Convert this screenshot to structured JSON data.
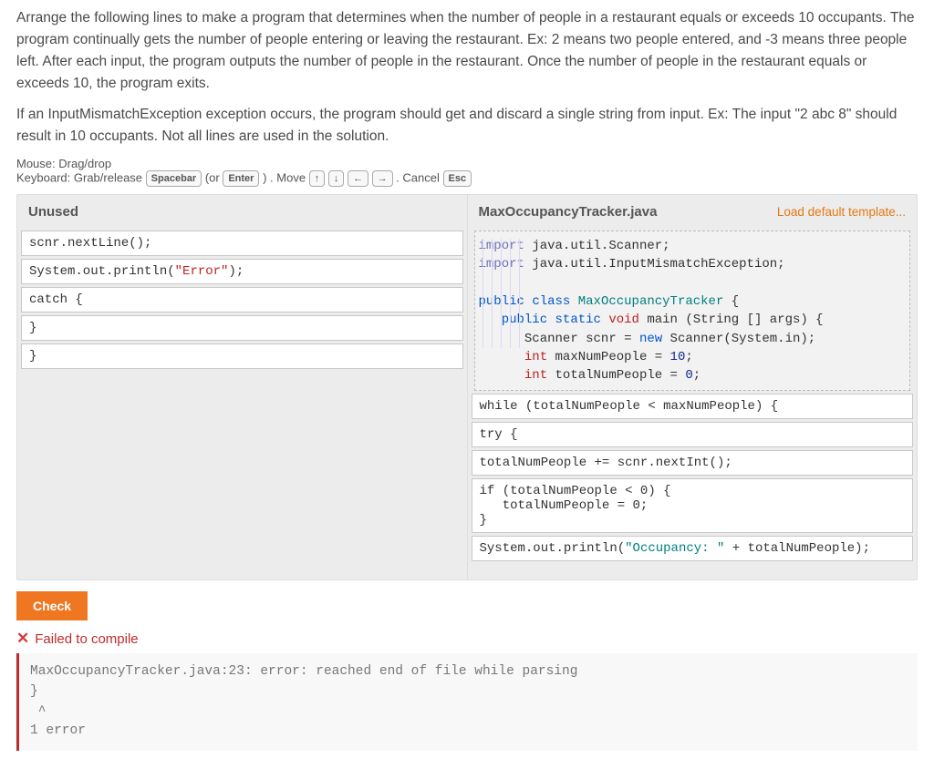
{
  "instructions": {
    "p1": "Arrange the following lines to make a program that determines when the number of people in a restaurant equals or exceeds 10 occupants. The program continually gets the number of people entering or leaving the restaurant. Ex: 2 means two people entered, and -3 means three people left. After each input, the program outputs the number of people in the restaurant. Once the number of people in the restaurant equals or exceeds 10, the program exits.",
    "p2": "If an InputMismatchException exception occurs, the program should get and discard a single string from input. Ex: The input \"2 abc 8\" should result in 10 occupants. Not all lines are used in the solution."
  },
  "hints": {
    "mouse": "Mouse: Drag/drop",
    "kb_prefix": "Keyboard: Grab/release",
    "kb_move": ". Move",
    "kb_cancel": ". Cancel",
    "or": "(or",
    "close_paren": ")",
    "key_spacebar": "Spacebar",
    "key_enter": "Enter",
    "key_up": "↑",
    "key_down": "↓",
    "key_left": "←",
    "key_right": "→",
    "key_esc": "Esc"
  },
  "left": {
    "header": "Unused",
    "items": [
      "scnr.nextLine();",
      "System.out.println(\"Error\");",
      "catch {",
      "}",
      "}"
    ]
  },
  "right": {
    "header": "MaxOccupancyTracker.java",
    "link": "Load default template...",
    "top_block": {
      "l0a": "import",
      "l0b": " java.util.Scanner;",
      "l1a": "import",
      "l1b": " java.util.InputMismatchException;",
      "blank": "",
      "l2a": "public ",
      "l2b": "class ",
      "l2c": "MaxOccupancyTracker",
      "l2d": " {",
      "l3a": "   public ",
      "l3b": "static ",
      "l3c": "void",
      "l3d": " main ",
      "l3e": "(String [] args) {",
      "l4a": "      Scanner scnr = ",
      "l4b": "new",
      "l4c": " Scanner(System.in);",
      "l5a": "      int",
      "l5b": " maxNumPeople = ",
      "l5c": "10",
      "l5d": ";",
      "l6a": "      int",
      "l6b": " totalNumPeople = ",
      "l6c": "0",
      "l6d": ";"
    },
    "placed": [
      "while (totalNumPeople < maxNumPeople) {",
      "try {",
      "totalNumPeople += scnr.nextInt();",
      "if (totalNumPeople < 0) {\n   totalNumPeople = 0;\n}"
    ],
    "placed_last_prefix": "System.out.println(",
    "placed_last_str": "\"Occupancy: \"",
    "placed_last_suffix": " + totalNumPeople);"
  },
  "buttons": {
    "check": "Check"
  },
  "result": {
    "x": "✕",
    "title": "Failed to compile",
    "error_text": "MaxOccupancyTracker.java:23: error: reached end of file while parsing\n}\n ^\n1 error"
  },
  "syntax": {
    "error_str": "\"Error\""
  }
}
